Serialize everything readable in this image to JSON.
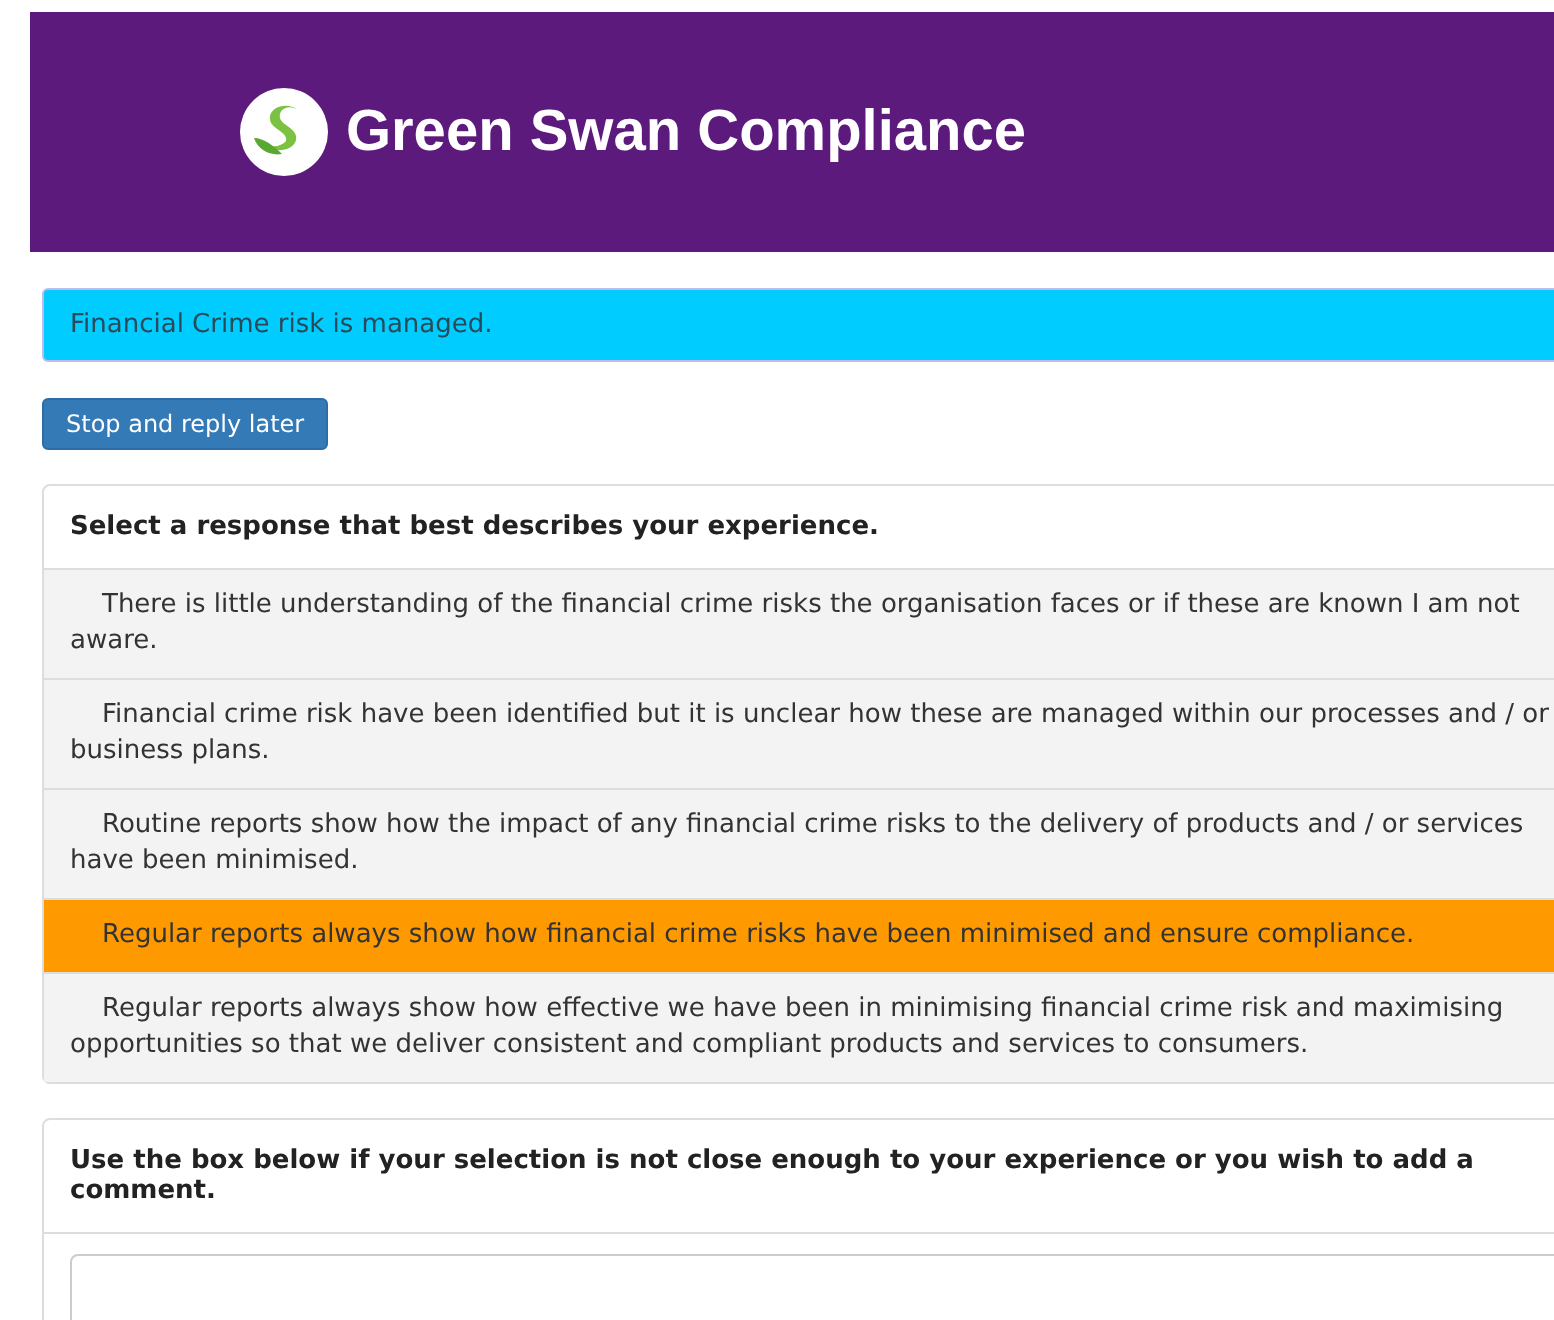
{
  "header": {
    "brand": "Green Swan Compliance"
  },
  "alert": {
    "text": "Financial Crime risk is managed."
  },
  "stop_button": {
    "label": "Stop and reply later"
  },
  "question": {
    "heading": "Select a response that best describes your experience.",
    "options": [
      {
        "text": "There is little understanding of the financial crime risks the organisation faces or if these are known I am not aware.",
        "selected": false
      },
      {
        "text": "Financial crime risk have been identified but it is unclear how these are managed within our processes and / or business plans.",
        "selected": false
      },
      {
        "text": "Routine reports show how the impact of any financial crime risks to the delivery of products and / or services have been minimised.",
        "selected": false
      },
      {
        "text": "Regular reports always show how financial crime risks have been minimised and ensure compliance.",
        "selected": true
      },
      {
        "text": "Regular reports always show how effective we have been in minimising financial crime risk and maximising opportunities so that we deliver consistent and compliant products and services to consumers.",
        "selected": false
      }
    ]
  },
  "comment": {
    "heading": "Use the box below if your selection is not close enough to your experience or you wish to add a comment."
  }
}
